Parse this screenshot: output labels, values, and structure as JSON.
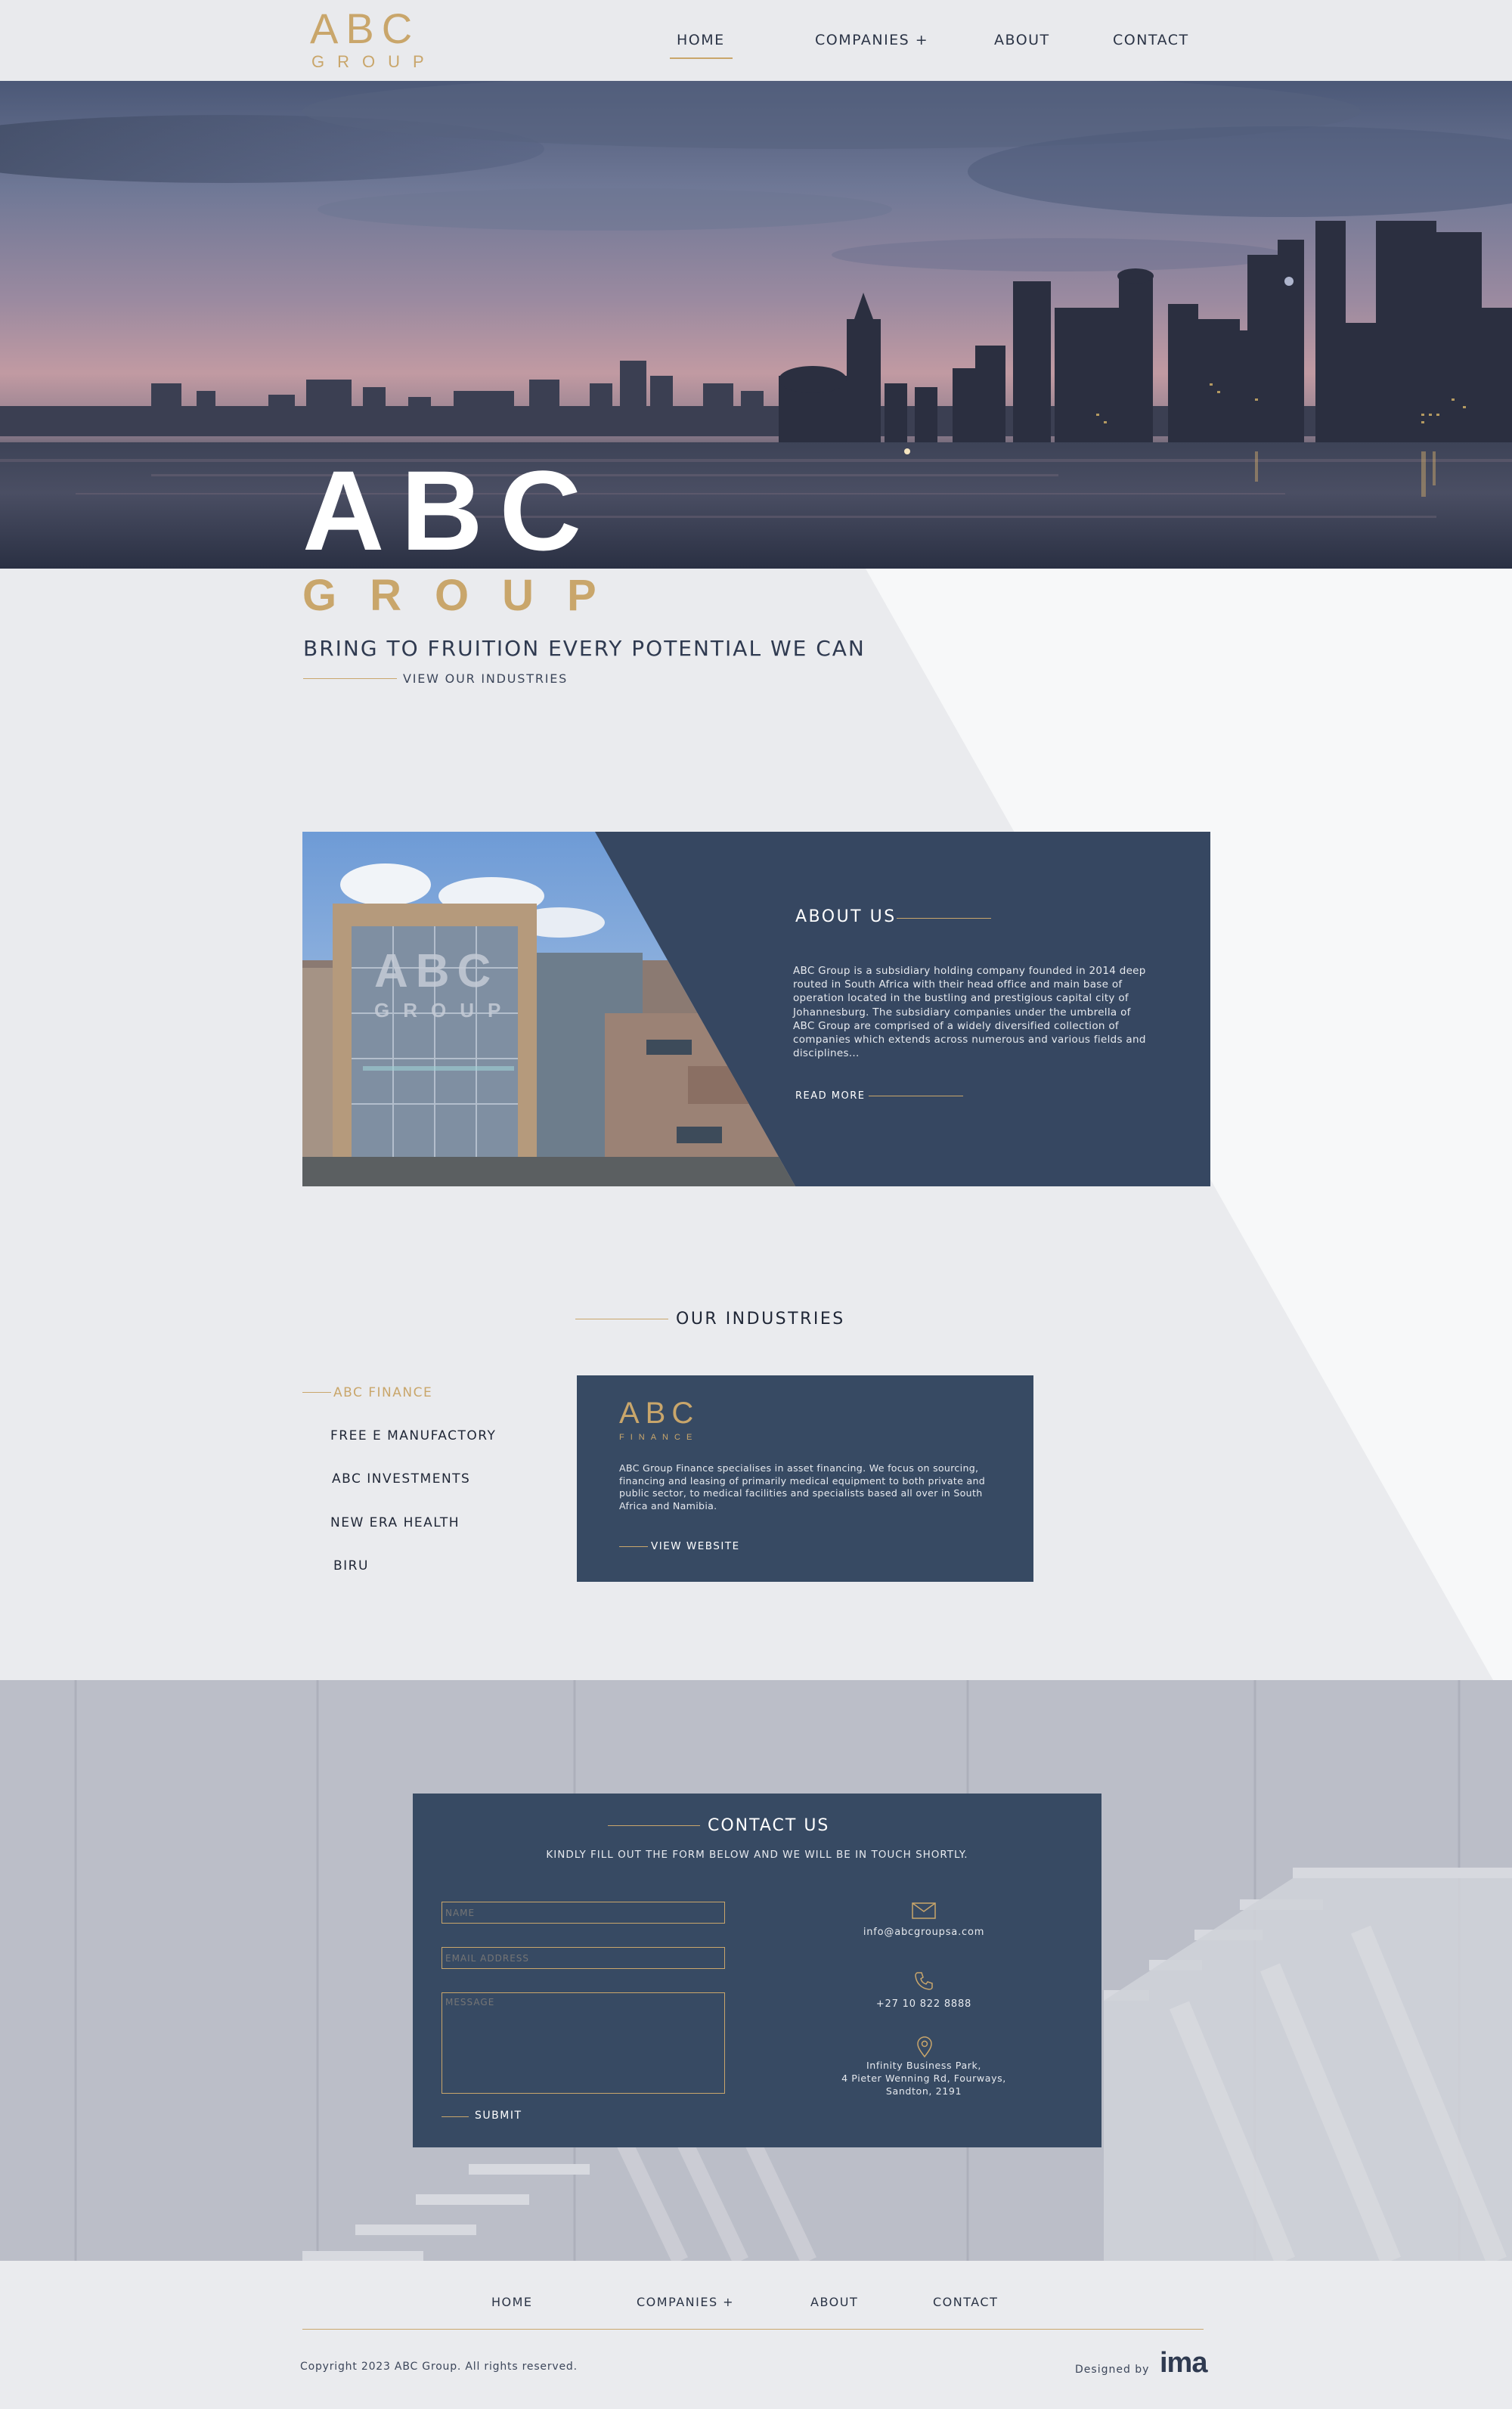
{
  "header": {
    "logo_top": "ABC",
    "logo_bottom": "GROUP",
    "nav": [
      {
        "label": "HOME"
      },
      {
        "label": "COMPANIES +"
      },
      {
        "label": "ABOUT"
      },
      {
        "label": "CONTACT"
      }
    ]
  },
  "hero": {
    "logo_top": "ABC",
    "logo_bottom": "GROUP",
    "tagline": "BRING TO FRUITION EVERY POTENTIAL WE CAN",
    "cta": "VIEW OUR INDUSTRIES"
  },
  "about": {
    "heading": "ABOUT US",
    "body": "ABC Group is a subsidiary holding company founded in 2014 deep routed in South Africa with their head office and main base of operation located in the bustling and prestigious capital city of Johannesburg. The subsidiary companies under the umbrella of ABC Group are comprised of a widely diversified collection of companies which extends across numerous and various fields and disciplines...",
    "read_more": "READ MORE",
    "sign_top": "ABC",
    "sign_bottom": "GROUP"
  },
  "industries": {
    "heading": "OUR INDUSTRIES",
    "items": [
      {
        "label": "ABC FINANCE"
      },
      {
        "label": "FREE E MANUFACTORY"
      },
      {
        "label": "ABC INVESTMENTS"
      },
      {
        "label": "NEW ERA HEALTH"
      },
      {
        "label": "BIRU"
      }
    ],
    "card": {
      "logo_top": "ABC",
      "logo_bottom": "FINANCE",
      "body": "ABC Group Finance specialises in asset financing. We focus on sourcing, financing and leasing of primarily medical equipment to both private and public sector, to medical facilities and specialists based all over in South Africa and Namibia.",
      "link": "VIEW WEBSITE"
    }
  },
  "contact": {
    "heading": "CONTACT US",
    "subheading": "KINDLY FILL OUT THE FORM BELOW AND WE WILL BE IN TOUCH SHORTLY.",
    "name_placeholder": "NAME",
    "email_placeholder": "EMAIL ADDRESS",
    "message_placeholder": "MESSAGE",
    "submit": "SUBMIT",
    "email": "info@abcgroupsa.com",
    "phone": "+27 10 822 8888",
    "address_line1": "Infinity Business Park,",
    "address_line2": "4 Pieter Wenning Rd, Fourways,",
    "address_line3": "Sandton, 2191"
  },
  "footer": {
    "nav": [
      {
        "label": "HOME"
      },
      {
        "label": "COMPANIES +"
      },
      {
        "label": "ABOUT"
      },
      {
        "label": "CONTACT"
      }
    ],
    "copyright": "Copyright 2023 ABC Group. All rights reserved.",
    "designed_by": "Designed by",
    "designer_logo": "ima"
  },
  "colors": {
    "gold": "#c9a66b",
    "navy": "#364761",
    "background": "#eaebee"
  }
}
